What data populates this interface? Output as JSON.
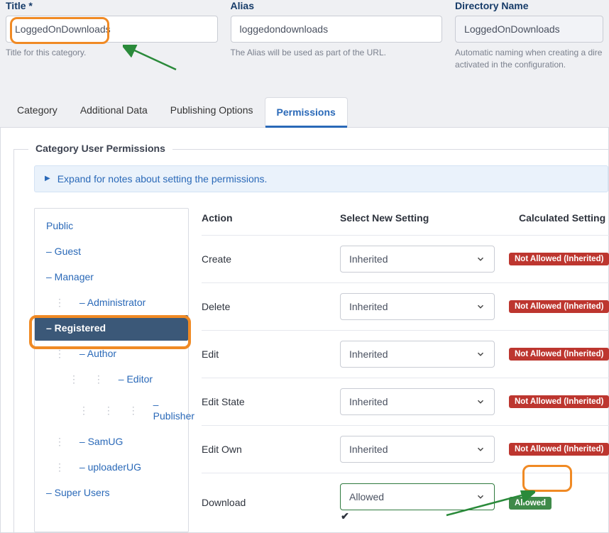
{
  "fields": {
    "title_label": "Title *",
    "title_value": "LoggedOnDownloads",
    "title_help": "Title for this category.",
    "alias_label": "Alias",
    "alias_value": "loggedondownloads",
    "alias_help": "The Alias will be used as part of the URL.",
    "dirname_label": "Directory Name",
    "dirname_value": "LoggedOnDownloads",
    "dirname_help": "Automatic naming when creating a dire activated in the configuration."
  },
  "tabs": {
    "category": "Category",
    "additional": "Additional Data",
    "publishing": "Publishing Options",
    "permissions": "Permissions"
  },
  "permissions_panel": {
    "legend": "Category User Permissions",
    "expand_text": "Expand for notes about setting the permissions.",
    "groups": {
      "public": "Public",
      "guest": "– Guest",
      "manager": "– Manager",
      "administrator": "– Administrator",
      "registered": "– Registered",
      "author": "– Author",
      "editor": "– Editor",
      "publisher": "– Publisher",
      "samug": "– SamUG",
      "uploaderug": "– uploaderUG",
      "superusers": "– Super Users"
    },
    "headers": {
      "action": "Action",
      "select": "Select New Setting",
      "calc": "Calculated Setting"
    },
    "rows": [
      {
        "action": "Create",
        "setting": "Inherited",
        "calc": "Not Allowed (Inherited)",
        "calc_class": "red",
        "check": false
      },
      {
        "action": "Delete",
        "setting": "Inherited",
        "calc": "Not Allowed (Inherited)",
        "calc_class": "red",
        "check": false
      },
      {
        "action": "Edit",
        "setting": "Inherited",
        "calc": "Not Allowed (Inherited)",
        "calc_class": "red",
        "check": false
      },
      {
        "action": "Edit State",
        "setting": "Inherited",
        "calc": "Not Allowed (Inherited)",
        "calc_class": "red",
        "check": false
      },
      {
        "action": "Edit Own",
        "setting": "Inherited",
        "calc": "Not Allowed (Inherited)",
        "calc_class": "red",
        "check": false
      },
      {
        "action": "Download",
        "setting": "Allowed",
        "calc": "Allowed",
        "calc_class": "green",
        "check": true
      }
    ]
  }
}
